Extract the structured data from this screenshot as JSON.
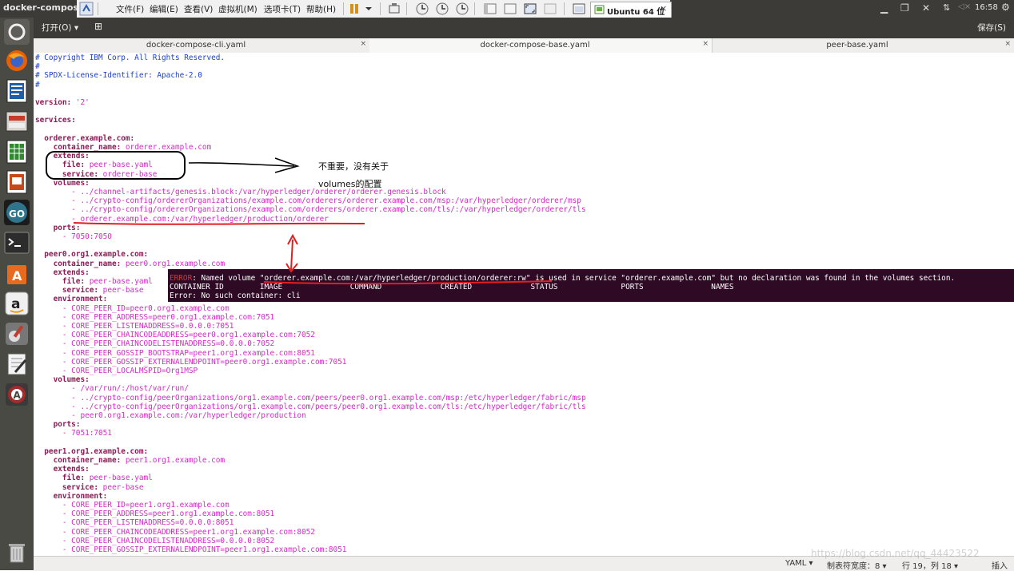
{
  "window": {
    "title": "docker-compose-base.yaml"
  },
  "vm_menu": [
    "文件(F)",
    "编辑(E)",
    "查看(V)",
    "虚拟机(M)",
    "选项卡(T)",
    "帮助(H)"
  ],
  "vm_tab": {
    "label": "Ubuntu 64 位",
    "close": "×"
  },
  "system": {
    "time": "16:58",
    "volume": "◁×"
  },
  "gedit": {
    "open_label": "打开(O)",
    "save_label": "保存(S)"
  },
  "tabs": [
    {
      "label": "docker-compose-cli.yaml",
      "close": "×"
    },
    {
      "label": "docker-compose-base.yaml",
      "close": "×"
    },
    {
      "label": "peer-base.yaml",
      "close": "×"
    }
  ],
  "code": [
    {
      "k": "",
      "v": "# Copyright IBM Corp. All Rights Reserved.",
      "c": 1
    },
    {
      "k": "",
      "v": "#",
      "c": 1
    },
    {
      "k": "",
      "v": "# SPDX-License-Identifier: Apache-2.0",
      "c": 1
    },
    {
      "k": "",
      "v": "#",
      "c": 1
    },
    {
      "k": "",
      "v": ""
    },
    {
      "k": "version",
      "v": " '2'"
    },
    {
      "k": "",
      "v": ""
    },
    {
      "k": "services",
      "v": ""
    },
    {
      "k": "",
      "v": ""
    },
    {
      "k": "  orderer.example.com",
      "v": ""
    },
    {
      "k": "    container_name",
      "v": " orderer.example.com"
    },
    {
      "k": "    extends",
      "v": ""
    },
    {
      "k": "      file",
      "v": " peer-base.yaml"
    },
    {
      "k": "      service",
      "v": " orderer-base"
    },
    {
      "k": "    volumes",
      "v": ""
    },
    {
      "k": "",
      "v": "        - ../channel-artifacts/genesis.block:/var/hyperledger/orderer/orderer.genesis.block"
    },
    {
      "k": "",
      "v": "        - ../crypto-config/ordererOrganizations/example.com/orderers/orderer.example.com/msp:/var/hyperledger/orderer/msp"
    },
    {
      "k": "",
      "v": "        - ../crypto-config/ordererOrganizations/example.com/orderers/orderer.example.com/tls/:/var/hyperledger/orderer/tls"
    },
    {
      "k": "",
      "v": "        - orderer.example.com:/var/hyperledger/production/orderer"
    },
    {
      "k": "    ports",
      "v": ""
    },
    {
      "k": "",
      "v": "      - 7050:7050"
    },
    {
      "k": "",
      "v": ""
    },
    {
      "k": "  peer0.org1.example.com",
      "v": ""
    },
    {
      "k": "    container_name",
      "v": " peer0.org1.example.com"
    },
    {
      "k": "    extends",
      "v": ""
    },
    {
      "k": "      file",
      "v": " peer-base.yaml"
    },
    {
      "k": "      service",
      "v": " peer-base"
    },
    {
      "k": "    environment",
      "v": ""
    },
    {
      "k": "",
      "v": "      - CORE_PEER_ID=peer0.org1.example.com"
    },
    {
      "k": "",
      "v": "      - CORE_PEER_ADDRESS=peer0.org1.example.com:7051"
    },
    {
      "k": "",
      "v": "      - CORE_PEER_LISTENADDRESS=0.0.0.0:7051"
    },
    {
      "k": "",
      "v": "      - CORE_PEER_CHAINCODEADDRESS=peer0.org1.example.com:7052"
    },
    {
      "k": "",
      "v": "      - CORE_PEER_CHAINCODELISTENADDRESS=0.0.0.0:7052"
    },
    {
      "k": "",
      "v": "      - CORE_PEER_GOSSIP_BOOTSTRAP=peer1.org1.example.com:8051"
    },
    {
      "k": "",
      "v": "      - CORE_PEER_GOSSIP_EXTERNALENDPOINT=peer0.org1.example.com:7051"
    },
    {
      "k": "",
      "v": "      - CORE_PEER_LOCALMSPID=Org1MSP"
    },
    {
      "k": "    volumes",
      "v": ""
    },
    {
      "k": "",
      "v": "        - /var/run/:/host/var/run/"
    },
    {
      "k": "",
      "v": "        - ../crypto-config/peerOrganizations/org1.example.com/peers/peer0.org1.example.com/msp:/etc/hyperledger/fabric/msp"
    },
    {
      "k": "",
      "v": "        - ../crypto-config/peerOrganizations/org1.example.com/peers/peer0.org1.example.com/tls:/etc/hyperledger/fabric/tls"
    },
    {
      "k": "",
      "v": "        - peer0.org1.example.com:/var/hyperledger/production"
    },
    {
      "k": "    ports",
      "v": ""
    },
    {
      "k": "",
      "v": "      - 7051:7051"
    },
    {
      "k": "",
      "v": ""
    },
    {
      "k": "  peer1.org1.example.com",
      "v": ""
    },
    {
      "k": "    container_name",
      "v": " peer1.org1.example.com"
    },
    {
      "k": "    extends",
      "v": ""
    },
    {
      "k": "      file",
      "v": " peer-base.yaml"
    },
    {
      "k": "      service",
      "v": " peer-base"
    },
    {
      "k": "    environment",
      "v": ""
    },
    {
      "k": "",
      "v": "      - CORE_PEER_ID=peer1.org1.example.com"
    },
    {
      "k": "",
      "v": "      - CORE_PEER_ADDRESS=peer1.org1.example.com:8051"
    },
    {
      "k": "",
      "v": "      - CORE_PEER_LISTENADDRESS=0.0.0.0:8051"
    },
    {
      "k": "",
      "v": "      - CORE_PEER_CHAINCODEADDRESS=peer1.org1.example.com:8052"
    },
    {
      "k": "",
      "v": "      - CORE_PEER_CHAINCODELISTENADDRESS=0.0.0.0:8052"
    },
    {
      "k": "",
      "v": "      - CORE_PEER_GOSSIP_EXTERNALENDPOINT=peer1.org1.example.com:8051"
    }
  ],
  "terminal": {
    "error_word": "ERROR",
    "error_text": ": Named volume \"orderer.example.com:/var/hyperledger/production/orderer:rw\" is used in service \"orderer.example.com\" but no declaration was found in the volumes section.",
    "header": "CONTAINER ID        IMAGE               COMMAND             CREATED             STATUS              PORTS               NAMES",
    "no_container": "Error: No such container: cli"
  },
  "annotation": {
    "line1": "不重要，没有关于",
    "line2": "volumes的配置"
  },
  "status": {
    "language": "YAML",
    "tab_width": "制表符宽度：8",
    "position": "行 19，列 18",
    "mode": "插入"
  },
  "watermark": "https://blog.csdn.net/qq_44423522",
  "colors": {
    "accent_red": "#e31e1e",
    "terminal_bg": "#2f0a24",
    "launcher_bg": "#4a4a45"
  }
}
